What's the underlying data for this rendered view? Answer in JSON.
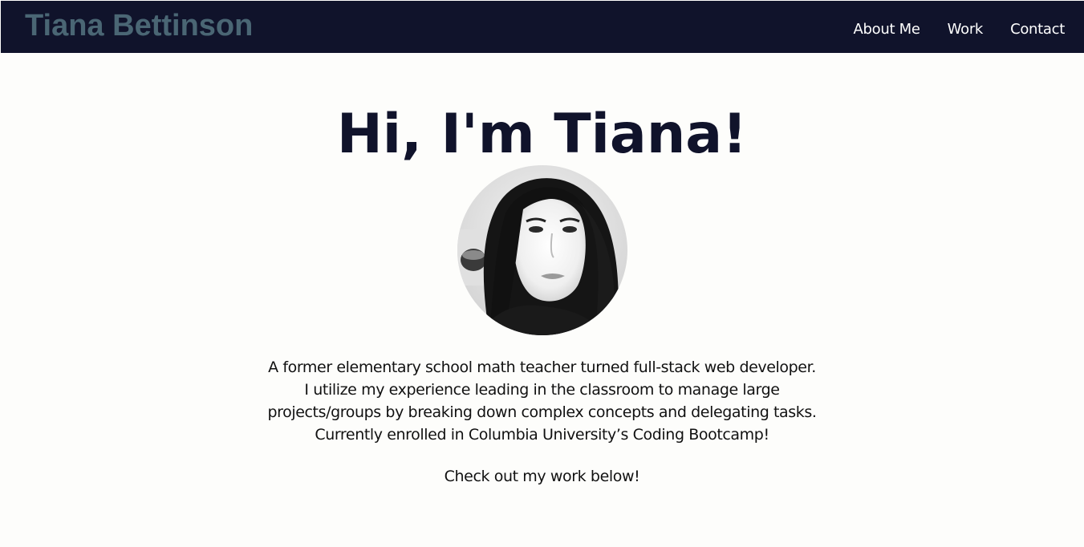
{
  "header": {
    "brand": "Tiana Bettinson",
    "nav": [
      {
        "label": "About Me"
      },
      {
        "label": "Work"
      },
      {
        "label": "Contact"
      }
    ]
  },
  "hero": {
    "title": "Hi, I'm Tiana!",
    "bio": "A former elementary school math teacher turned full-stack web developer. I utilize my experience leading in the classroom to manage large projects/groups by breaking down complex concepts and delegating tasks. Currently enrolled in Columbia University’s Coding Bootcamp!",
    "cta": "Check out my work below!"
  },
  "colors": {
    "navbar_bg": "#10132b",
    "brand_text": "#4a6674",
    "page_bg": "#fdfdfb",
    "title_text": "#10132b"
  }
}
